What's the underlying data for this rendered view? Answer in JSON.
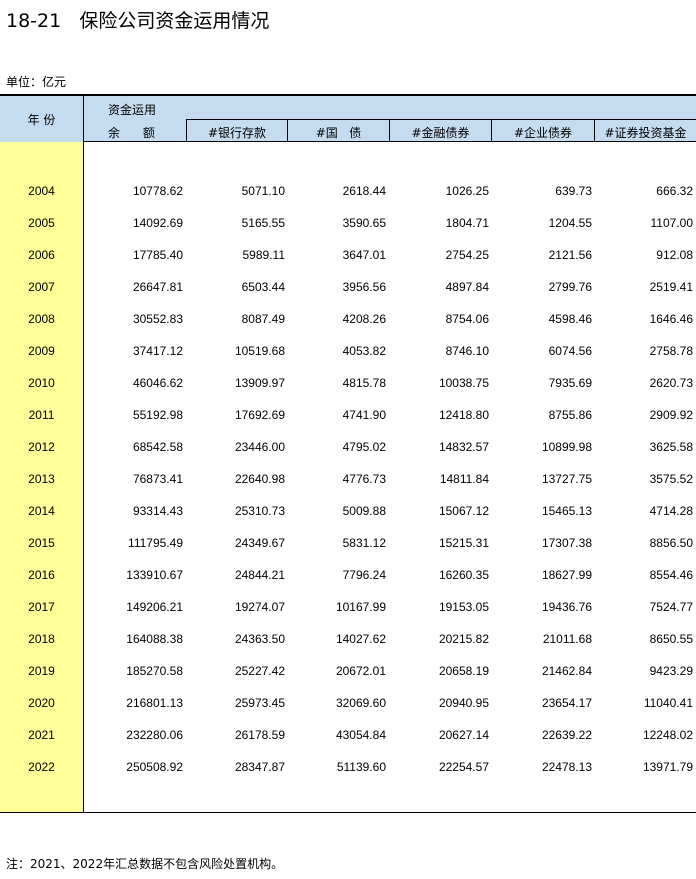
{
  "title": "18-21   保险公司资金运用情况",
  "unit": "单位：亿元",
  "header": {
    "year": "年 份",
    "group": "资金运用",
    "balance": "余      额",
    "cols": [
      "#银行存款",
      "#国   债",
      "#金融债券",
      "#企业债券",
      "#证券投资基金"
    ]
  },
  "rows": [
    {
      "year": "2004",
      "values": [
        "10778.62",
        "5071.10",
        "2618.44",
        "1026.25",
        "639.73",
        "666.32"
      ]
    },
    {
      "year": "2005",
      "values": [
        "14092.69",
        "5165.55",
        "3590.65",
        "1804.71",
        "1204.55",
        "1107.00"
      ]
    },
    {
      "year": "2006",
      "values": [
        "17785.40",
        "5989.11",
        "3647.01",
        "2754.25",
        "2121.56",
        "912.08"
      ]
    },
    {
      "year": "2007",
      "values": [
        "26647.81",
        "6503.44",
        "3956.56",
        "4897.84",
        "2799.76",
        "2519.41"
      ]
    },
    {
      "year": "2008",
      "values": [
        "30552.83",
        "8087.49",
        "4208.26",
        "8754.06",
        "4598.46",
        "1646.46"
      ]
    },
    {
      "year": "2009",
      "values": [
        "37417.12",
        "10519.68",
        "4053.82",
        "8746.10",
        "6074.56",
        "2758.78"
      ]
    },
    {
      "year": "2010",
      "values": [
        "46046.62",
        "13909.97",
        "4815.78",
        "10038.75",
        "7935.69",
        "2620.73"
      ]
    },
    {
      "year": "2011",
      "values": [
        "55192.98",
        "17692.69",
        "4741.90",
        "12418.80",
        "8755.86",
        "2909.92"
      ]
    },
    {
      "year": "2012",
      "values": [
        "68542.58",
        "23446.00",
        "4795.02",
        "14832.57",
        "10899.98",
        "3625.58"
      ]
    },
    {
      "year": "2013",
      "values": [
        "76873.41",
        "22640.98",
        "4776.73",
        "14811.84",
        "13727.75",
        "3575.52"
      ]
    },
    {
      "year": "2014",
      "values": [
        "93314.43",
        "25310.73",
        "5009.88",
        "15067.12",
        "15465.13",
        "4714.28"
      ]
    },
    {
      "year": "2015",
      "values": [
        "111795.49",
        "24349.67",
        "5831.12",
        "15215.31",
        "17307.38",
        "8856.50"
      ]
    },
    {
      "year": "2016",
      "values": [
        "133910.67",
        "24844.21",
        "7796.24",
        "16260.35",
        "18627.99",
        "8554.46"
      ]
    },
    {
      "year": "2017",
      "values": [
        "149206.21",
        "19274.07",
        "10167.99",
        "19153.05",
        "19436.76",
        "7524.77"
      ]
    },
    {
      "year": "2018",
      "values": [
        "164088.38",
        "24363.50",
        "14027.62",
        "20215.82",
        "21011.68",
        "8650.55"
      ]
    },
    {
      "year": "2019",
      "values": [
        "185270.58",
        "25227.42",
        "20672.01",
        "20658.19",
        "21462.84",
        "9423.29"
      ]
    },
    {
      "year": "2020",
      "values": [
        "216801.13",
        "25973.45",
        "32069.60",
        "20940.95",
        "23654.17",
        "11040.41"
      ]
    },
    {
      "year": "2021",
      "values": [
        "232280.06",
        "26178.59",
        "43054.84",
        "20627.14",
        "22639.22",
        "12248.02"
      ]
    },
    {
      "year": "2022",
      "values": [
        "250508.92",
        "28347.87",
        "51139.60",
        "22254.57",
        "22478.13",
        "13971.79"
      ]
    }
  ],
  "note": "注：2021、2022年汇总数据不包含风险处置机构。"
}
